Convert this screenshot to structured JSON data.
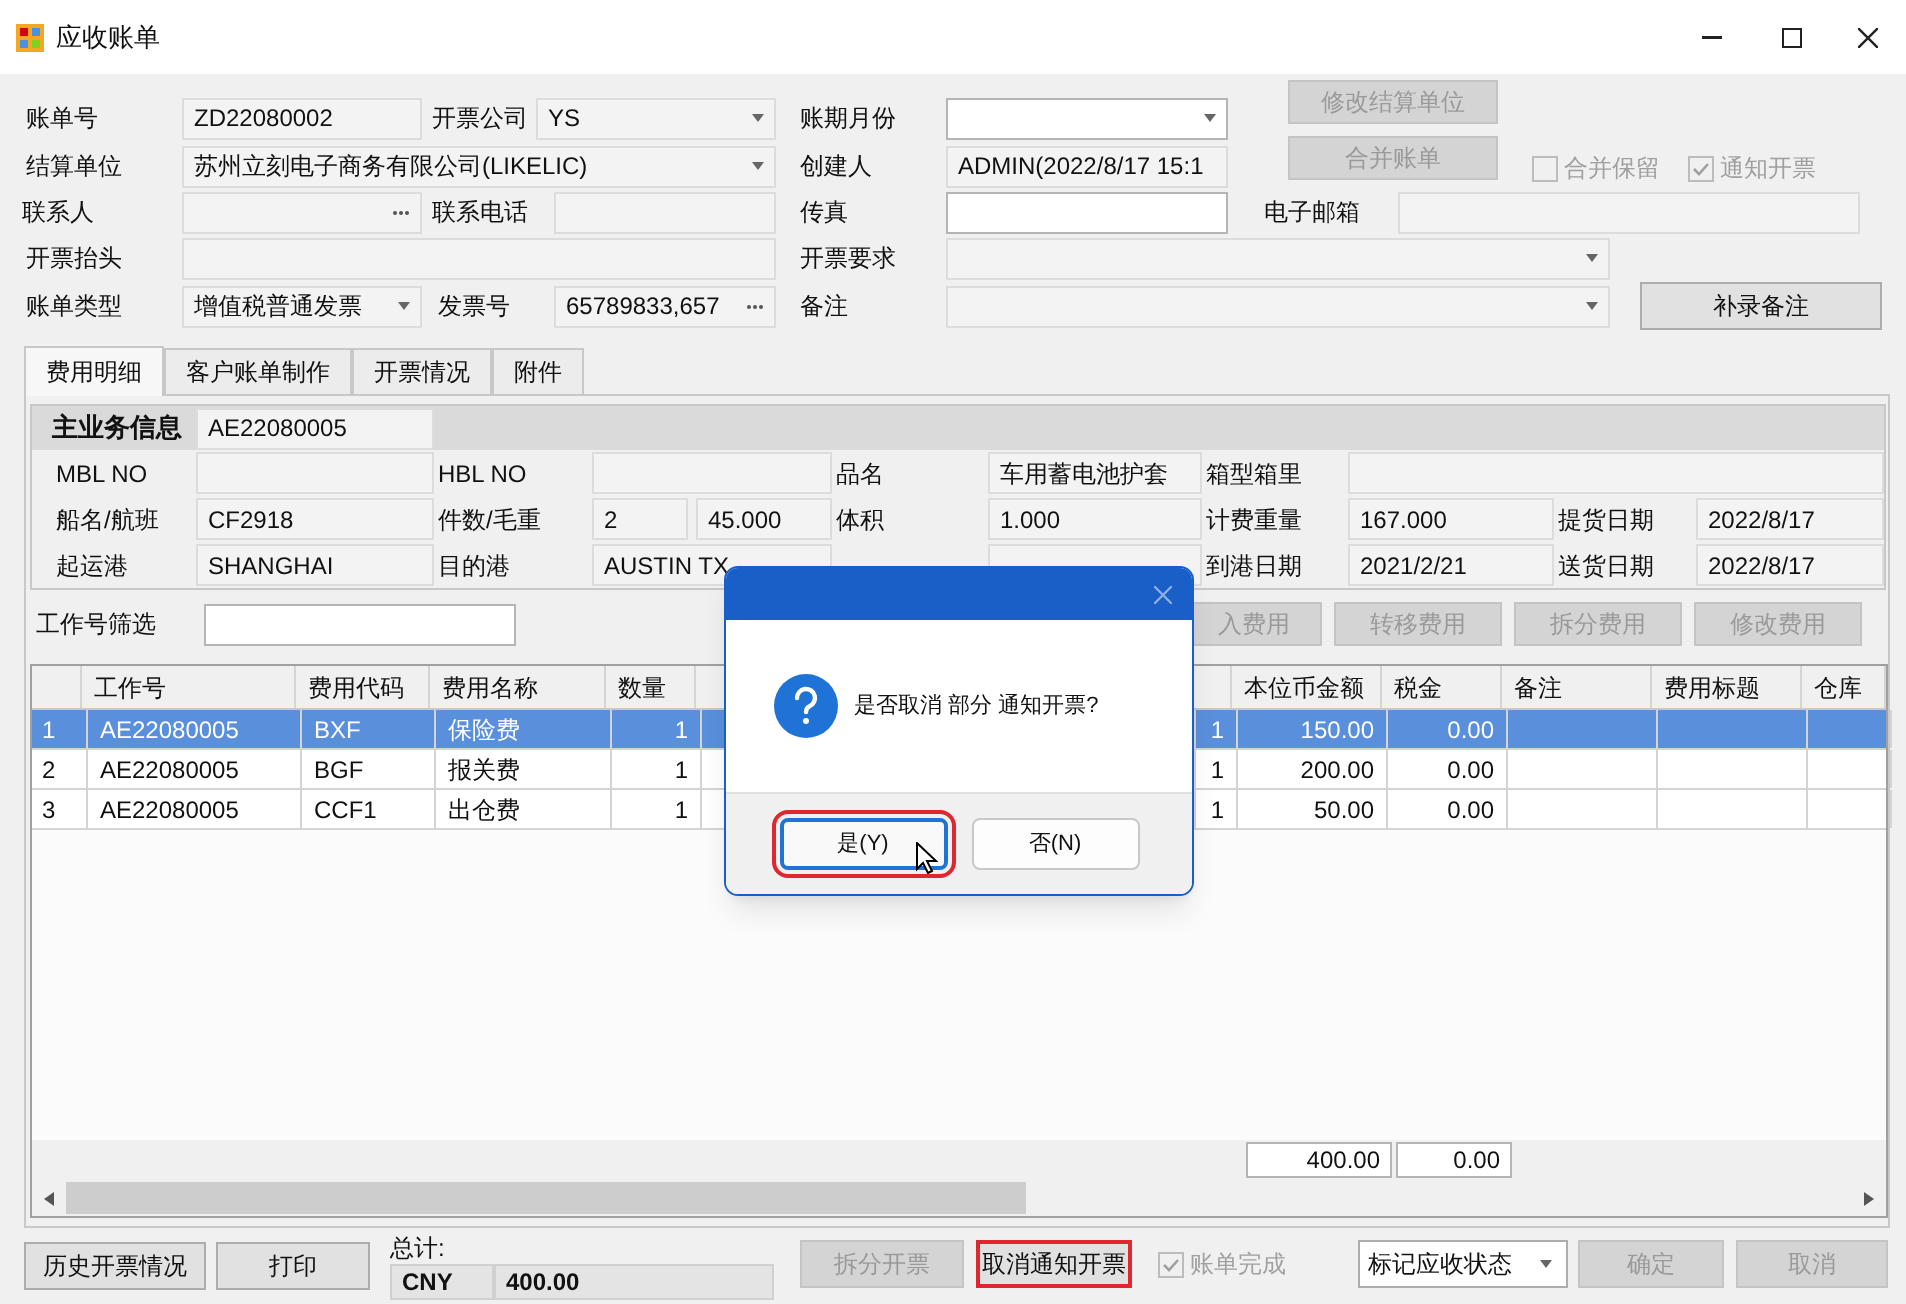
{
  "window": {
    "title": "应收账单"
  },
  "bill_form": {
    "bill_no": {
      "label": "账单号",
      "value": "ZD22080002"
    },
    "invoice_company": {
      "label": "开票公司",
      "value": "YS"
    },
    "period_month": {
      "label": "账期月份"
    },
    "settlement_unit": {
      "label": "结算单位",
      "value": "苏州立刻电子商务有限公司(LIKELIC)"
    },
    "creator": {
      "label": "创建人",
      "value": "ADMIN(2022/8/17 15:1"
    },
    "contact": {
      "label": "联系人"
    },
    "phone": {
      "label": "联系电话"
    },
    "fax": {
      "label": "传真"
    },
    "email": {
      "label": "电子邮箱"
    },
    "invoice_title": {
      "label": "开票抬头"
    },
    "invoice_requirement": {
      "label": "开票要求"
    },
    "bill_type": {
      "label": "账单类型",
      "value": "增值税普通发票"
    },
    "invoice_no": {
      "label": "发票号",
      "value": "65789833,657"
    },
    "remark": {
      "label": "备注"
    }
  },
  "top_buttons": [
    {
      "label": "修改结算单位",
      "disabled": true
    },
    {
      "label": "合并账单",
      "disabled": true
    }
  ],
  "add_remark_button": {
    "label": "补录备注",
    "disabled": false
  },
  "checkboxes": [
    {
      "label": "合并保留",
      "checked": false,
      "disabled": true
    },
    {
      "label": "通知开票",
      "checked": true,
      "disabled": true
    }
  ],
  "tabs": [
    {
      "label": "费用明细",
      "selected": true
    },
    {
      "label": "客户账单制作",
      "selected": false
    },
    {
      "label": "开票情况",
      "selected": false
    },
    {
      "label": "附件",
      "selected": false
    }
  ],
  "business_info": {
    "title": "主业务信息",
    "job_no": "AE22080005",
    "rows": [
      [
        {
          "label": "MBL NO"
        },
        {
          "label": "HBL NO"
        },
        {
          "label": "品名",
          "value": "车用蓄电池护套"
        },
        {
          "label": "箱型箱里"
        }
      ],
      [
        {
          "label": "船名/航班",
          "value": "CF2918"
        },
        {
          "label": "件数/毛重",
          "value": "2",
          "value2": "45.000"
        },
        {
          "label": "体积",
          "value": "1.000"
        },
        {
          "label": "计费重量",
          "value": "167.000"
        },
        {
          "label": "提货日期",
          "value": "2022/8/17"
        }
      ],
      [
        {
          "label": "起运港",
          "value": "SHANGHAI"
        },
        {
          "label": "目的港",
          "value": "AUSTIN TX"
        },
        {},
        {
          "label": "到港日期",
          "value": "2021/2/21"
        },
        {
          "label": "送货日期",
          "value": "2022/8/17"
        }
      ]
    ]
  },
  "filter": {
    "label": "工作号筛选"
  },
  "fee_buttons": [
    {
      "label": "入费用",
      "disabled": true
    },
    {
      "label": "转移费用",
      "disabled": true
    },
    {
      "label": "拆分费用",
      "disabled": true
    },
    {
      "label": "修改费用",
      "disabled": true
    }
  ],
  "table": {
    "columns": [
      "工作号",
      "费用代码",
      "费用名称",
      "数量",
      "",
      "",
      "本位币金额",
      "税金",
      "备注",
      "费用标题",
      "仓库"
    ],
    "rows": [
      {
        "index": "1",
        "selected": true,
        "cells": [
          "AE22080005",
          "BXF",
          "保险费",
          "1",
          "",
          "1",
          "150.00",
          "0.00",
          "",
          "",
          ""
        ]
      },
      {
        "index": "2",
        "selected": false,
        "cells": [
          "AE22080005",
          "BGF",
          "报关费",
          "1",
          "",
          "1",
          "200.00",
          "0.00",
          "",
          "",
          ""
        ]
      },
      {
        "index": "3",
        "selected": false,
        "cells": [
          "AE22080005",
          "CCF1",
          "出仓费",
          "1",
          "",
          "1",
          "50.00",
          "0.00",
          "",
          "",
          ""
        ]
      }
    ],
    "totals": [
      "400.00",
      "0.00"
    ]
  },
  "footer": {
    "history_button": "历史开票情况",
    "print_button": "打印",
    "total_label": "总计:",
    "currency": "CNY",
    "total": "400.00",
    "split_invoice": {
      "label": "拆分开票",
      "disabled": true,
      "highlighted": false
    },
    "cancel_notice": {
      "label": "取消通知开票",
      "disabled": false,
      "highlighted": true
    },
    "bill_complete": {
      "label": "账单完成",
      "checked": true,
      "disabled": true
    },
    "status_combo": {
      "value": "标记应收状态"
    },
    "confirm": {
      "label": "确定",
      "disabled": true
    },
    "cancel": {
      "label": "取消",
      "disabled": true
    }
  },
  "dialog": {
    "message": "是否取消 部分 通知开票?",
    "buttons": [
      {
        "label": "是(Y)",
        "selected": true,
        "highlighted": true
      },
      {
        "label": "否(N)",
        "selected": false,
        "highlighted": false
      }
    ]
  }
}
